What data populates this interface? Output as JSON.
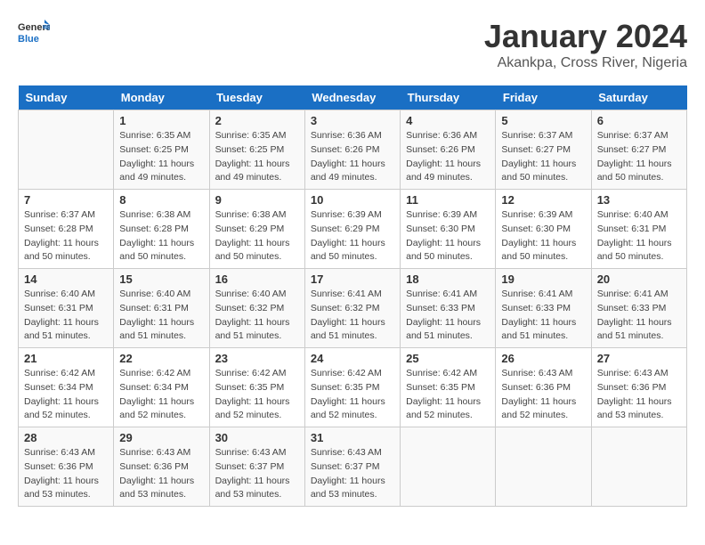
{
  "header": {
    "logo_general": "General",
    "logo_blue": "Blue",
    "title": "January 2024",
    "subtitle": "Akankpa, Cross River, Nigeria"
  },
  "columns": [
    "Sunday",
    "Monday",
    "Tuesday",
    "Wednesday",
    "Thursday",
    "Friday",
    "Saturday"
  ],
  "weeks": [
    [
      {
        "day": "",
        "sunrise": "",
        "sunset": "",
        "daylight": ""
      },
      {
        "day": "1",
        "sunrise": "Sunrise: 6:35 AM",
        "sunset": "Sunset: 6:25 PM",
        "daylight": "Daylight: 11 hours and 49 minutes."
      },
      {
        "day": "2",
        "sunrise": "Sunrise: 6:35 AM",
        "sunset": "Sunset: 6:25 PM",
        "daylight": "Daylight: 11 hours and 49 minutes."
      },
      {
        "day": "3",
        "sunrise": "Sunrise: 6:36 AM",
        "sunset": "Sunset: 6:26 PM",
        "daylight": "Daylight: 11 hours and 49 minutes."
      },
      {
        "day": "4",
        "sunrise": "Sunrise: 6:36 AM",
        "sunset": "Sunset: 6:26 PM",
        "daylight": "Daylight: 11 hours and 49 minutes."
      },
      {
        "day": "5",
        "sunrise": "Sunrise: 6:37 AM",
        "sunset": "Sunset: 6:27 PM",
        "daylight": "Daylight: 11 hours and 50 minutes."
      },
      {
        "day": "6",
        "sunrise": "Sunrise: 6:37 AM",
        "sunset": "Sunset: 6:27 PM",
        "daylight": "Daylight: 11 hours and 50 minutes."
      }
    ],
    [
      {
        "day": "7",
        "sunrise": "Sunrise: 6:37 AM",
        "sunset": "Sunset: 6:28 PM",
        "daylight": "Daylight: 11 hours and 50 minutes."
      },
      {
        "day": "8",
        "sunrise": "Sunrise: 6:38 AM",
        "sunset": "Sunset: 6:28 PM",
        "daylight": "Daylight: 11 hours and 50 minutes."
      },
      {
        "day": "9",
        "sunrise": "Sunrise: 6:38 AM",
        "sunset": "Sunset: 6:29 PM",
        "daylight": "Daylight: 11 hours and 50 minutes."
      },
      {
        "day": "10",
        "sunrise": "Sunrise: 6:39 AM",
        "sunset": "Sunset: 6:29 PM",
        "daylight": "Daylight: 11 hours and 50 minutes."
      },
      {
        "day": "11",
        "sunrise": "Sunrise: 6:39 AM",
        "sunset": "Sunset: 6:30 PM",
        "daylight": "Daylight: 11 hours and 50 minutes."
      },
      {
        "day": "12",
        "sunrise": "Sunrise: 6:39 AM",
        "sunset": "Sunset: 6:30 PM",
        "daylight": "Daylight: 11 hours and 50 minutes."
      },
      {
        "day": "13",
        "sunrise": "Sunrise: 6:40 AM",
        "sunset": "Sunset: 6:31 PM",
        "daylight": "Daylight: 11 hours and 50 minutes."
      }
    ],
    [
      {
        "day": "14",
        "sunrise": "Sunrise: 6:40 AM",
        "sunset": "Sunset: 6:31 PM",
        "daylight": "Daylight: 11 hours and 51 minutes."
      },
      {
        "day": "15",
        "sunrise": "Sunrise: 6:40 AM",
        "sunset": "Sunset: 6:31 PM",
        "daylight": "Daylight: 11 hours and 51 minutes."
      },
      {
        "day": "16",
        "sunrise": "Sunrise: 6:40 AM",
        "sunset": "Sunset: 6:32 PM",
        "daylight": "Daylight: 11 hours and 51 minutes."
      },
      {
        "day": "17",
        "sunrise": "Sunrise: 6:41 AM",
        "sunset": "Sunset: 6:32 PM",
        "daylight": "Daylight: 11 hours and 51 minutes."
      },
      {
        "day": "18",
        "sunrise": "Sunrise: 6:41 AM",
        "sunset": "Sunset: 6:33 PM",
        "daylight": "Daylight: 11 hours and 51 minutes."
      },
      {
        "day": "19",
        "sunrise": "Sunrise: 6:41 AM",
        "sunset": "Sunset: 6:33 PM",
        "daylight": "Daylight: 11 hours and 51 minutes."
      },
      {
        "day": "20",
        "sunrise": "Sunrise: 6:41 AM",
        "sunset": "Sunset: 6:33 PM",
        "daylight": "Daylight: 11 hours and 51 minutes."
      }
    ],
    [
      {
        "day": "21",
        "sunrise": "Sunrise: 6:42 AM",
        "sunset": "Sunset: 6:34 PM",
        "daylight": "Daylight: 11 hours and 52 minutes."
      },
      {
        "day": "22",
        "sunrise": "Sunrise: 6:42 AM",
        "sunset": "Sunset: 6:34 PM",
        "daylight": "Daylight: 11 hours and 52 minutes."
      },
      {
        "day": "23",
        "sunrise": "Sunrise: 6:42 AM",
        "sunset": "Sunset: 6:35 PM",
        "daylight": "Daylight: 11 hours and 52 minutes."
      },
      {
        "day": "24",
        "sunrise": "Sunrise: 6:42 AM",
        "sunset": "Sunset: 6:35 PM",
        "daylight": "Daylight: 11 hours and 52 minutes."
      },
      {
        "day": "25",
        "sunrise": "Sunrise: 6:42 AM",
        "sunset": "Sunset: 6:35 PM",
        "daylight": "Daylight: 11 hours and 52 minutes."
      },
      {
        "day": "26",
        "sunrise": "Sunrise: 6:43 AM",
        "sunset": "Sunset: 6:36 PM",
        "daylight": "Daylight: 11 hours and 52 minutes."
      },
      {
        "day": "27",
        "sunrise": "Sunrise: 6:43 AM",
        "sunset": "Sunset: 6:36 PM",
        "daylight": "Daylight: 11 hours and 53 minutes."
      }
    ],
    [
      {
        "day": "28",
        "sunrise": "Sunrise: 6:43 AM",
        "sunset": "Sunset: 6:36 PM",
        "daylight": "Daylight: 11 hours and 53 minutes."
      },
      {
        "day": "29",
        "sunrise": "Sunrise: 6:43 AM",
        "sunset": "Sunset: 6:36 PM",
        "daylight": "Daylight: 11 hours and 53 minutes."
      },
      {
        "day": "30",
        "sunrise": "Sunrise: 6:43 AM",
        "sunset": "Sunset: 6:37 PM",
        "daylight": "Daylight: 11 hours and 53 minutes."
      },
      {
        "day": "31",
        "sunrise": "Sunrise: 6:43 AM",
        "sunset": "Sunset: 6:37 PM",
        "daylight": "Daylight: 11 hours and 53 minutes."
      },
      {
        "day": "",
        "sunrise": "",
        "sunset": "",
        "daylight": ""
      },
      {
        "day": "",
        "sunrise": "",
        "sunset": "",
        "daylight": ""
      },
      {
        "day": "",
        "sunrise": "",
        "sunset": "",
        "daylight": ""
      }
    ]
  ]
}
